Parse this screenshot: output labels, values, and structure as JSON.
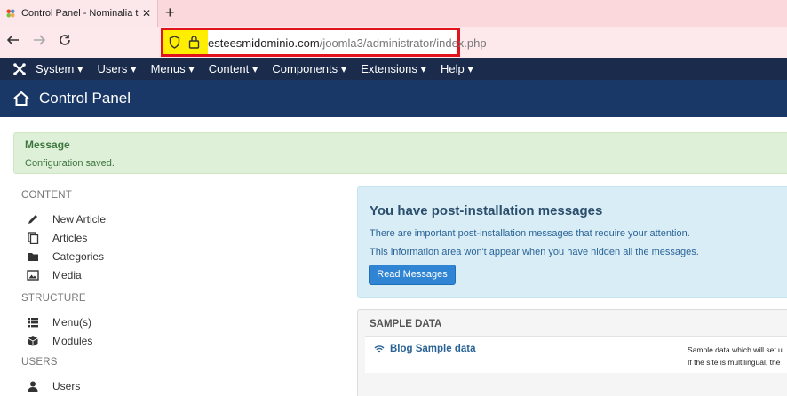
{
  "browser": {
    "tab_title": "Control Panel - Nominalia test",
    "tab_close": "✕",
    "new_tab": "+",
    "url_domain": "esteesmidominio.com",
    "url_path": "/joomla3/administrator/index.php"
  },
  "topmenu": {
    "items": [
      {
        "label": "System ▾"
      },
      {
        "label": "Users ▾"
      },
      {
        "label": "Menus ▾"
      },
      {
        "label": "Content ▾"
      },
      {
        "label": "Components ▾"
      },
      {
        "label": "Extensions ▾"
      },
      {
        "label": "Help ▾"
      }
    ]
  },
  "header": {
    "title": "Control Panel"
  },
  "alert": {
    "heading": "Message",
    "text": "Configuration saved."
  },
  "sidebar": {
    "content_heading": "CONTENT",
    "content_items": [
      "New Article",
      "Articles",
      "Categories",
      "Media"
    ],
    "structure_heading": "STRUCTURE",
    "structure_items": [
      "Menu(s)",
      "Modules"
    ],
    "users_heading": "USERS",
    "users_items": [
      "Users"
    ]
  },
  "postinstall": {
    "title": "You have post-installation messages",
    "text1": "There are important post-installation messages that require your attention.",
    "text2": "This information area won't appear when you have hidden all the messages.",
    "button": "Read Messages"
  },
  "sample_data": {
    "heading": "SAMPLE DATA",
    "link": "Blog Sample data",
    "desc1": "Sample data which will set u",
    "desc2": "If the site is multilingual, the"
  },
  "colors": {
    "topmenu_bg": "#1a2b4c",
    "header_bg": "#1a3867",
    "highlight_border": "#e1141d",
    "alert_bg": "#dff0d8",
    "info_bg": "#d9edf7",
    "button_bg": "#2f84d3"
  }
}
